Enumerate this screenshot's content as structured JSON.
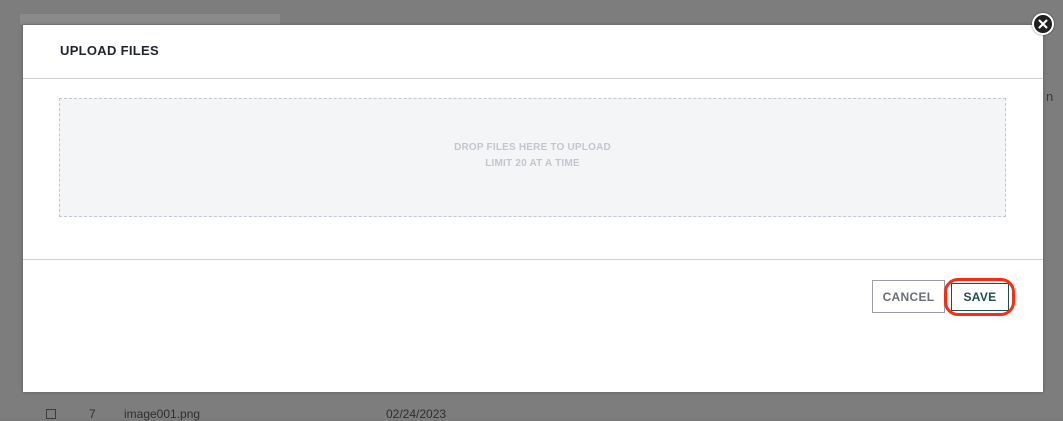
{
  "modal": {
    "title": "UPLOAD FILES",
    "dropzone": {
      "line1": "DROP FILES HERE TO UPLOAD",
      "line2": "LIMIT 20 AT A TIME"
    },
    "buttons": {
      "cancel_label": "CANCEL",
      "save_label": "SAVE"
    },
    "close_icon": "close-icon"
  },
  "background": {
    "edge_text": "n",
    "row": {
      "number": "7",
      "filename": "image001.png",
      "date": "02/24/2023"
    }
  },
  "colors": {
    "overlay": "#7d7d7d",
    "modal_bg": "#ffffff",
    "save_accent": "#1f4f4a",
    "highlight": "#ff2a12",
    "dropzone_bg": "#f4f5f7"
  }
}
